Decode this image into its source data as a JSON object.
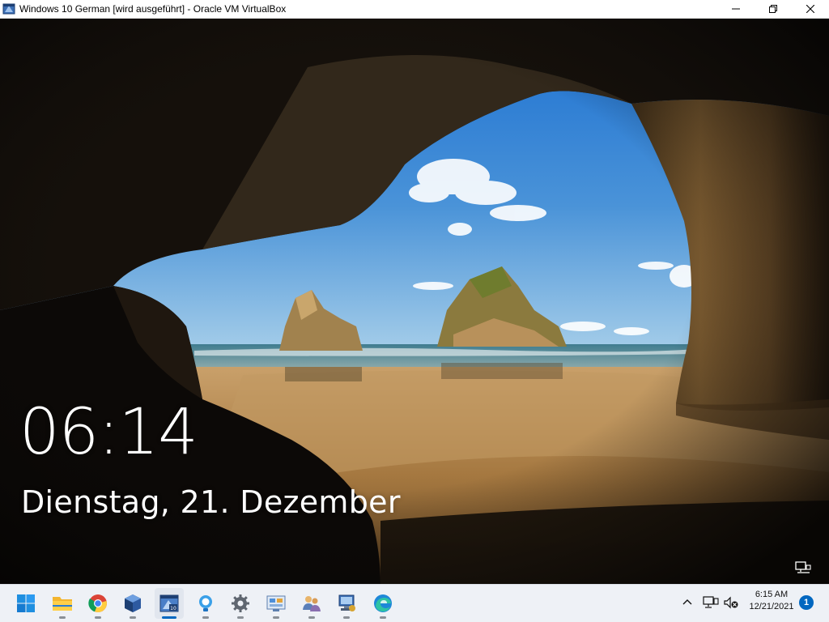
{
  "window": {
    "title": "Windows 10 German [wird ausgeführt] - Oracle VM VirtualBox",
    "icon": "virtualbox-vm-icon",
    "controls": [
      "minimize",
      "maximize",
      "close"
    ]
  },
  "lockscreen": {
    "time": "06:14",
    "date": "Dienstag, 21. Dezember",
    "wallpaper": "sea cave arch with rocks, beach and blue sky",
    "network_icon": "network-icon"
  },
  "taskbar": {
    "apps": [
      {
        "name": "start",
        "icon": "windows-start-icon",
        "running": false
      },
      {
        "name": "file-explorer",
        "icon": "folder-icon",
        "running": true
      },
      {
        "name": "chrome",
        "icon": "chrome-icon",
        "running": true
      },
      {
        "name": "virtualbox",
        "icon": "virtualbox-icon",
        "running": true
      },
      {
        "name": "windows-10-vm",
        "icon": "vm-window-icon",
        "running": true,
        "active": true
      },
      {
        "name": "tips",
        "icon": "lightbulb-icon",
        "running": true
      },
      {
        "name": "settings",
        "icon": "gear-icon",
        "running": true
      },
      {
        "name": "network-admin",
        "icon": "network-tool-icon",
        "running": true
      },
      {
        "name": "users-groups",
        "icon": "users-icon",
        "running": true
      },
      {
        "name": "remote-desktop",
        "icon": "remote-desktop-icon",
        "running": true
      },
      {
        "name": "edge",
        "icon": "edge-icon",
        "running": true
      }
    ],
    "tray": {
      "time": "6:15 AM",
      "date": "12/21/2021",
      "notifications": "1"
    }
  },
  "colors": {
    "accent": "#0067c0",
    "taskbar_bg": "#eef1f6",
    "sky": "#2f7fd4",
    "sand": "#b58a4f"
  }
}
